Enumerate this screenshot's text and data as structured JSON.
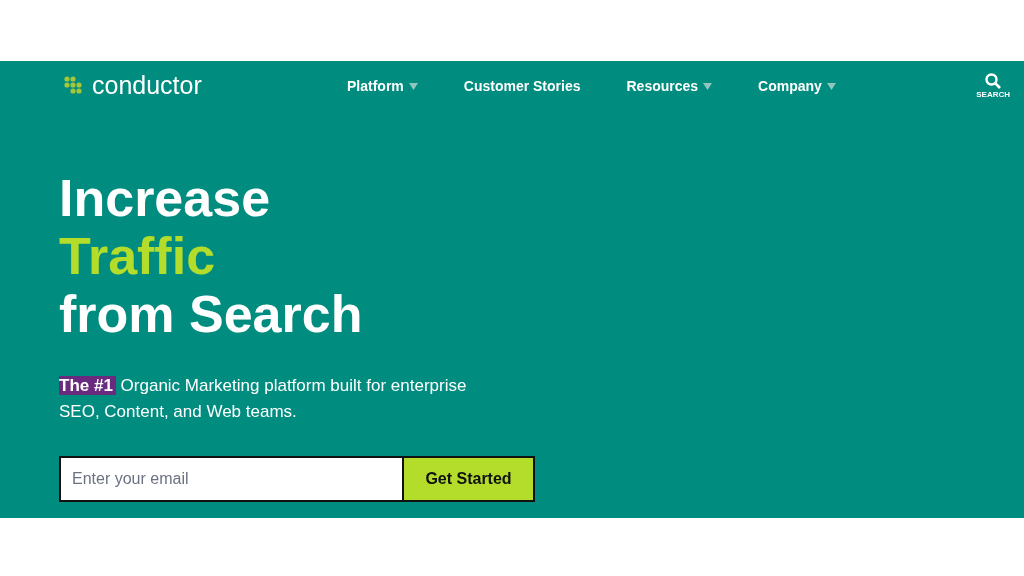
{
  "header": {
    "logo": "conductor",
    "nav": [
      {
        "label": "Platform",
        "dropdown": true
      },
      {
        "label": "Customer Stories",
        "dropdown": false
      },
      {
        "label": "Resources",
        "dropdown": true
      },
      {
        "label": "Company",
        "dropdown": true
      }
    ],
    "search_label": "SEARCH"
  },
  "hero": {
    "headline": [
      {
        "text": "Increase",
        "accent": false
      },
      {
        "text": "Traffic",
        "accent": true
      },
      {
        "text": "from Search",
        "accent": false
      }
    ],
    "tagline": {
      "highlight": "The #1",
      "text": "Organic Marketing platform built for enterprise SEO, Content, and Web teams."
    },
    "email": {
      "placeholder": "Enter your email"
    },
    "cta": "Get Started"
  }
}
